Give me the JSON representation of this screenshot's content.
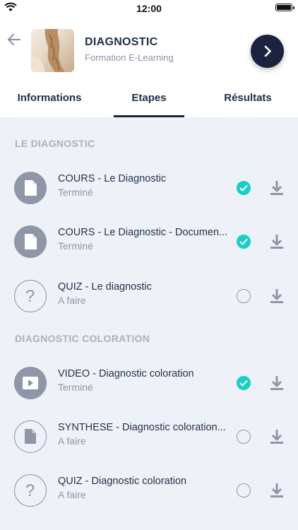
{
  "status": {
    "time": "12:00"
  },
  "header": {
    "title": "DIAGNOSTIC",
    "subtitle": "Formation E-Learning"
  },
  "tabs": [
    {
      "label": "Informations"
    },
    {
      "label": "Etapes"
    },
    {
      "label": "Résultats"
    }
  ],
  "active_tab": "Etapes",
  "sections": [
    {
      "title": "LE DIAGNOSTIC"
    },
    {
      "title": "DIAGNOSTIC COLORATION"
    }
  ],
  "items": [
    {
      "title": "COURS - Le Diagnostic",
      "status": "Terminé",
      "icon": "document-icon",
      "completed": true
    },
    {
      "title": "COURS - Le Diagnostic - Documen...",
      "status": "Terminé",
      "icon": "document-icon",
      "completed": true
    },
    {
      "title": "QUIZ - Le diagnostic",
      "status": "A faire",
      "icon": "question-icon",
      "completed": false
    },
    {
      "title": "VIDEO - Diagnostic coloration",
      "status": "Terminé",
      "icon": "video-icon",
      "completed": true
    },
    {
      "title": "SYNTHESE - Diagnostic coloration...",
      "status": "A faire",
      "icon": "document-icon",
      "completed": false
    },
    {
      "title": "QUIZ - Diagnostic coloration",
      "status": "A faire",
      "icon": "question-icon",
      "completed": false
    }
  ],
  "colors": {
    "accent": "#1c2340",
    "check": "#19cfc4",
    "muted": "#8e96a7",
    "background": "#eef2f8"
  }
}
